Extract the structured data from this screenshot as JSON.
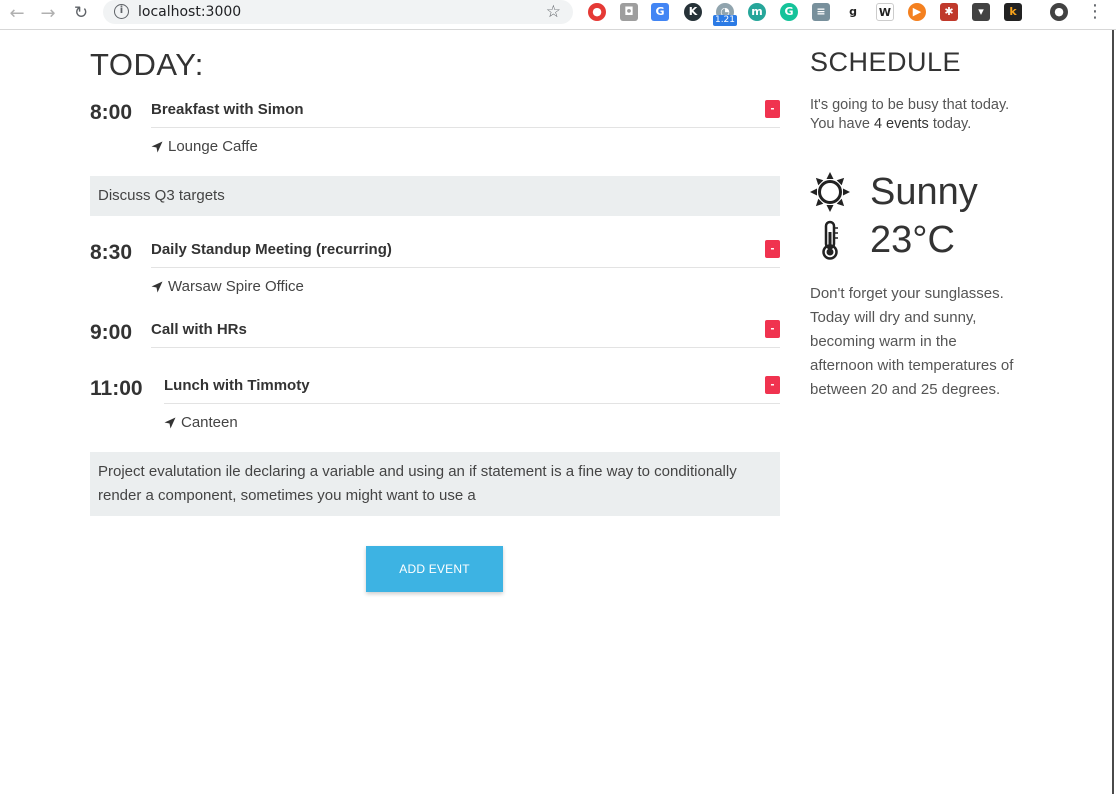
{
  "browser": {
    "url": "localhost:3000",
    "badge": "1.21"
  },
  "main": {
    "title": "TODAY:",
    "events": [
      {
        "time": "8:00",
        "title": "Breakfast with Simon",
        "location": "Lounge Caffe",
        "remove_label": "-"
      },
      {
        "time": "8:30",
        "title": "Daily Standup Meeting (recurring)",
        "location": "Warsaw Spire Office",
        "remove_label": "-"
      },
      {
        "time": "9:00",
        "title": "Call with HRs",
        "remove_label": "-"
      },
      {
        "time": "11:00",
        "title": "Lunch with Timmoty",
        "location": "Canteen",
        "remove_label": "-"
      }
    ],
    "notes": [
      "Discuss Q3 targets",
      "Project evalutation ile declaring a variable and using an if statement is a fine way to conditionally render a component, sometimes you might want to use a"
    ],
    "add_button": "ADD EVENT"
  },
  "sidebar": {
    "title": "SCHEDULE",
    "summary_before": "It's going to be busy that today. You have ",
    "summary_count": "4 events",
    "summary_after": " today.",
    "weather": {
      "condition": "Sunny",
      "temperature": "23°C",
      "condition_icon": "sun-icon",
      "temperature_icon": "thermometer-icon"
    },
    "forecast": "Don't forget your sunglasses. Today will dry and sunny, becoming warm in the afternoon with temperatures of between 20 and 25 degrees."
  },
  "colors": {
    "remove": "#f0334f",
    "add_button": "#3db3e3",
    "note_bg": "#ebeeef"
  }
}
